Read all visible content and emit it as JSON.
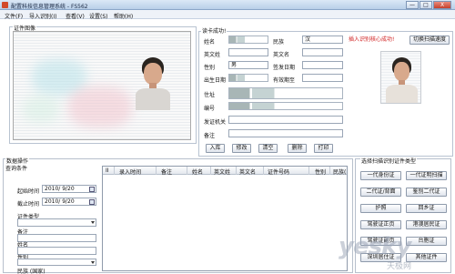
{
  "window": {
    "title": "配置科技信息管理系统  - FS562",
    "min_label": "—",
    "max_label": "□",
    "close_label": "X"
  },
  "menu": [
    "文件(F)",
    "导入识别(I)",
    "查看(V)",
    "设置(S)",
    "帮助(H)"
  ],
  "scan_area": {
    "label": "证件图像"
  },
  "read_result": {
    "status_label": "读卡成功!",
    "name_label": "姓名",
    "name_value": "",
    "ethnicity_label": "民族",
    "ethnicity_value": "汉",
    "english_name_label": "英文姓",
    "english_surname_label": "英文名",
    "gender_label": "性别",
    "gender_value": "男",
    "issue_date_label": "签发日期",
    "birth_label": "出生日期",
    "expiry_label": "有效期至",
    "address_label": "住址",
    "number_label": "编号",
    "authority_label": "发证机关",
    "remark_label": "备注",
    "right_status": "插入识别核心成功!",
    "switch_button": "切换扫描速度"
  },
  "actions": [
    "入库",
    "修改",
    "清空",
    "删除",
    "打印"
  ],
  "data_ops": {
    "title": "数据操作",
    "query_title": "查询条件",
    "start_label": "起始时间",
    "start_value": "2010/ 9/20",
    "end_label": "截止时间",
    "end_value": "2010/ 9/20",
    "type_label": "证件类型",
    "remark_label": "备注",
    "name_label": "姓名",
    "gender_label": "性别",
    "ethnicity_label": "民族 (国家)"
  },
  "table": {
    "columns": [
      "II",
      "录入时间",
      "备注",
      "姓名",
      "英文姓",
      "英文名",
      "证件号码",
      "性别",
      "民族("
    ]
  },
  "id_types": {
    "title": "选择扫描识别证件类型",
    "buttons": [
      [
        "一代身份证",
        "一代证明扫描"
      ],
      [
        "二代证/背面",
        "鉴别二代证"
      ],
      [
        "护照",
        "回乡证"
      ],
      [
        "驾驶证正页",
        "港澳居民证"
      ],
      [
        "驾驶证副页",
        "台胞证"
      ],
      [
        "深圳居住证",
        "其他证件"
      ]
    ]
  },
  "watermark": {
    "main": "yesky",
    "sub": "天极网"
  },
  "colors": {
    "status_red": "#d01e1e",
    "accent_blue": "#8aa6c8"
  }
}
